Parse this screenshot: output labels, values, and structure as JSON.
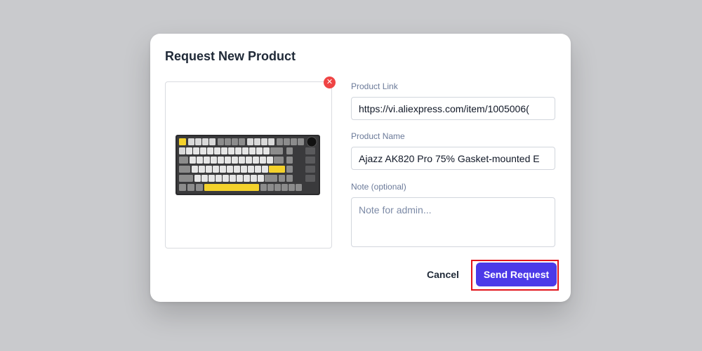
{
  "modal": {
    "title": "Request New Product",
    "remove_image_icon": "close-icon",
    "fields": {
      "product_link": {
        "label": "Product Link",
        "value": "https://vi.aliexpress.com/item/1005006("
      },
      "product_name": {
        "label": "Product Name",
        "value": "Ajazz AK820 Pro 75% Gasket-mounted E"
      },
      "note": {
        "label": "Note (optional)",
        "placeholder": "Note for admin..."
      }
    },
    "actions": {
      "cancel_label": "Cancel",
      "send_label": "Send Request"
    }
  },
  "colors": {
    "backdrop": "#c9cacd",
    "primary": "#4c3ae8",
    "danger": "#ef4444",
    "highlight": "#e3141b"
  }
}
